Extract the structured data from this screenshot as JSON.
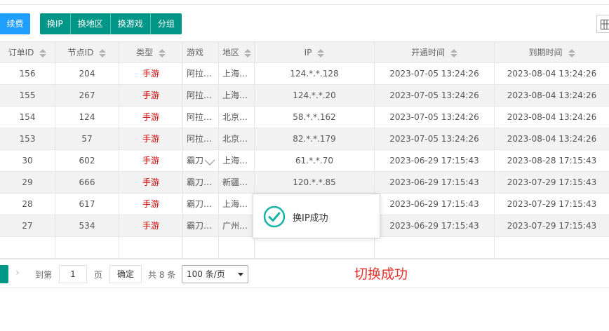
{
  "toolbar": {
    "renew_label": "续费",
    "group_buttons": [
      "换IP",
      "换地区",
      "换游戏",
      "分组"
    ]
  },
  "table": {
    "headers": [
      "订单ID",
      "节点ID",
      "类型",
      "游戏",
      "地区",
      "IP",
      "开通时间",
      "到期时间"
    ],
    "rows": [
      [
        "156",
        "204",
        "手游",
        "阿拉…",
        "上海…",
        "124.*.*.128",
        "2023-07-05 13:24:26",
        "2023-08-04 13:24:26"
      ],
      [
        "155",
        "267",
        "手游",
        "阿拉…",
        "上海…",
        "124.*.*.20",
        "2023-07-05 13:24:26",
        "2023-08-04 13:24:26"
      ],
      [
        "154",
        "124",
        "手游",
        "阿拉…",
        "北京…",
        "58.*.*.162",
        "2023-07-05 13:24:26",
        "2023-08-04 13:24:26"
      ],
      [
        "153",
        "57",
        "手游",
        "阿拉…",
        "北京…",
        "82.*.*.179",
        "2023-07-05 13:24:26",
        "2023-08-04 13:24:26"
      ],
      [
        "30",
        "602",
        "手游",
        "霸刀",
        "上海…",
        "61.*.*.70",
        "2023-06-29 17:15:43",
        "2023-08-28 17:15:43"
      ],
      [
        "29",
        "666",
        "手游",
        "霸刀…",
        "新疆…",
        "120.*.*.85",
        "2023-06-29 17:15:43",
        "2023-07-29 17:15:43"
      ],
      [
        "28",
        "617",
        "手游",
        "霸刀…",
        "上海…",
        "",
        "2023-06-29 17:15:43",
        "2023-07-29 17:15:43"
      ],
      [
        "27",
        "534",
        "手游",
        "霸刀…",
        "广州…",
        "",
        "2023-06-29 17:15:43",
        "2023-07-29 17:15:43"
      ]
    ]
  },
  "toast": {
    "message": "换IP成功",
    "icon": "check-circle-icon",
    "color": "#16b3a4"
  },
  "pager": {
    "goto_label": "到第",
    "page_value": "1",
    "page_unit": "页",
    "confirm_label": "确定",
    "total_label": "共 8 条",
    "page_size": "100 条/页"
  },
  "annotation": {
    "text": "切换成功",
    "color": "#e8302a"
  },
  "colors": {
    "primary": "#009688",
    "renew": "#1e9fff",
    "type_red": "#cc0000"
  }
}
